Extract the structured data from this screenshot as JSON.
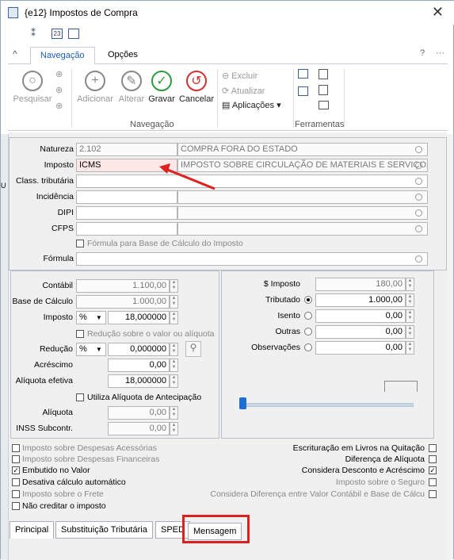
{
  "window": {
    "title": "{e12} Impostos de Compra",
    "close": "✕"
  },
  "tabs": {
    "nav": "Navegação",
    "opts": "Opções",
    "help": "?",
    "more": "···"
  },
  "ribbon": {
    "pesquisar": "Pesquisar",
    "adicionar": "Adicionar",
    "alterar": "Alterar",
    "gravar": "Gravar",
    "cancelar": "Cancelar",
    "excluir": "Excluir",
    "atualizar": "Atualizar",
    "aplicacoes": "Aplicações",
    "group_nav": "Navegação",
    "group_tools": "Ferramentas"
  },
  "header_form": {
    "natureza_label": "Natureza",
    "natureza_code": "2.102",
    "natureza_desc": "COMPRA FORA DO ESTADO",
    "imposto_label": "Imposto",
    "imposto_code": "ICMS",
    "imposto_desc": "IMPOSTO SOBRE CIRCULAÇÃO DE MATERIAIS E SERVIÇOS",
    "class_label": "Class. tributária",
    "incidencia_label": "Incidência",
    "dipi_label": "DIPI",
    "cfps_label": "CFPS",
    "formula_check": "Fórmula para Base de Cálculo do Imposto",
    "formula_label": "Fórmula"
  },
  "left_values": {
    "contabil_label": "Contábil",
    "contabil": "1.100,00",
    "base_label": "Base de Cálculo",
    "base": "1.000,00",
    "imposto_label": "Imposto",
    "imposto_unit": "%",
    "imposto": "18,000000",
    "reducao_check": "Redução sobre o valor ou alíquota",
    "reducao_label": "Redução",
    "reducao_unit": "%",
    "reducao": "0,000000",
    "acrescimo_label": "Acréscimo",
    "acrescimo": "0,00",
    "aliq_label": "Alíquota efetiva",
    "aliq": "18,000000",
    "antecip_check": "Utiliza Alíquota de Antecipação",
    "aliquota_label": "Alíquota",
    "aliquota": "0,00",
    "inss_label": "INSS Subcontr.",
    "inss": "0,00"
  },
  "right_values": {
    "simposto_label": "$ Imposto",
    "simposto": "180,00",
    "tributado_label": "Tributado",
    "tributado": "1.000,00",
    "isento_label": "Isento",
    "isento": "0,00",
    "outras_label": "Outras",
    "outras": "0,00",
    "obs_label": "Observações",
    "obs": "0,00"
  },
  "checks_left": [
    {
      "label": "Imposto sobre Despesas Acessórias",
      "checked": false,
      "dim": true
    },
    {
      "label": "Imposto sobre Despesas Financeiras",
      "checked": false,
      "dim": true
    },
    {
      "label": "Embutido no Valor",
      "checked": true,
      "dim": false
    },
    {
      "label": "Desativa cálculo automático",
      "checked": false,
      "dim": false
    },
    {
      "label": "Imposto sobre o Frete",
      "checked": false,
      "dim": true
    },
    {
      "label": "Não creditar o imposto",
      "checked": false,
      "dim": false
    }
  ],
  "checks_right": [
    {
      "label": "Escrituração em Livros na Quitação",
      "checked": false,
      "dim": false
    },
    {
      "label": "Diferença de Alíquota",
      "checked": false,
      "dim": false
    },
    {
      "label": "Considera Desconto e Acréscimo",
      "checked": true,
      "dim": false
    },
    {
      "label": "Imposto sobre o Seguro",
      "checked": false,
      "dim": true
    },
    {
      "label": "Considera Diferença entre Valor Contábil e Base de Cálcu",
      "checked": false,
      "dim": true
    }
  ],
  "bottom_tabs": {
    "principal": "Principal",
    "subst": "Substituição Tributária",
    "sped": "SPED",
    "mensagem": "Mensagem"
  },
  "colors": {
    "highlight": "#e0201f",
    "accent": "#1d5fb0"
  }
}
